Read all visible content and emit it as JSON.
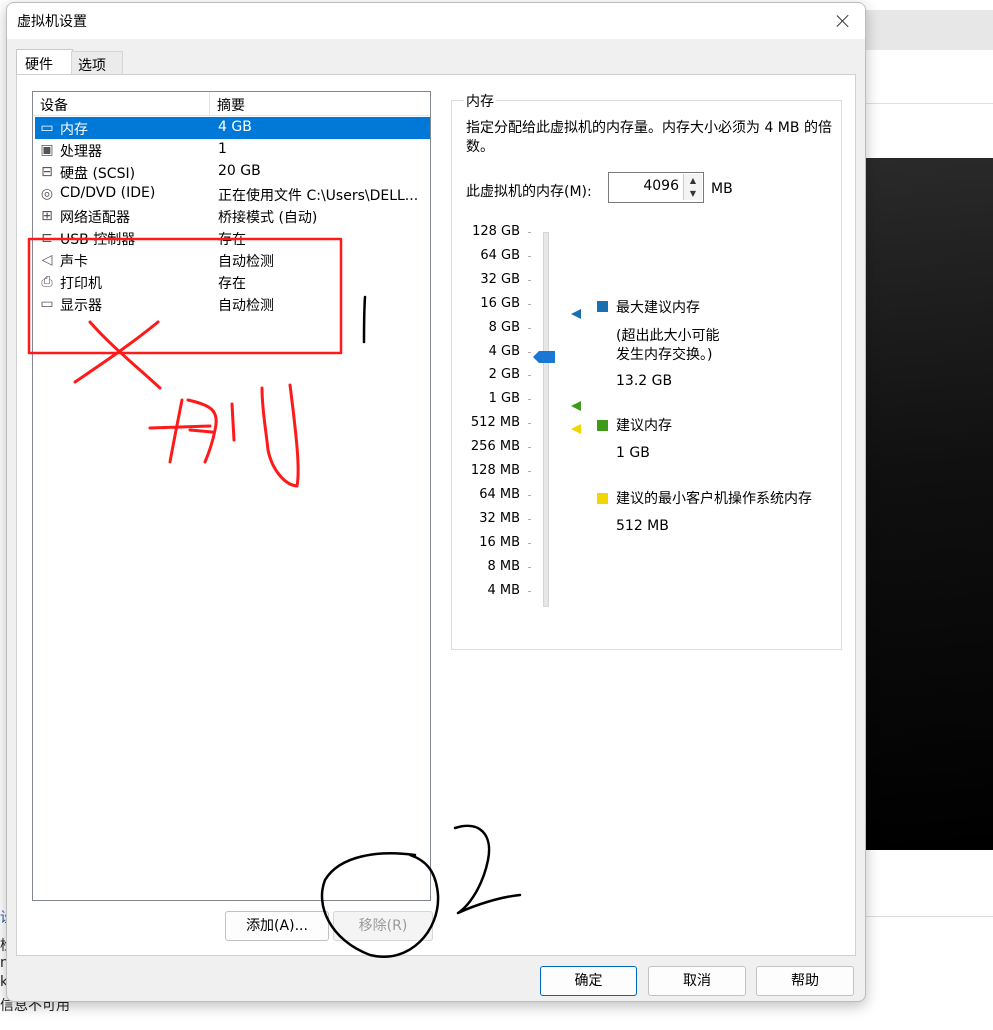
{
  "background": {
    "fragment_lines": [
      "设",
      "检",
      "n",
      "k",
      "信息不可用"
    ]
  },
  "dialog": {
    "title": "虚拟机设置",
    "tabs": [
      {
        "label": "硬件",
        "selected": true
      },
      {
        "label": "选项",
        "selected": false
      }
    ],
    "device_list": {
      "columns": [
        "设备",
        "摘要"
      ],
      "rows": [
        {
          "icon": "memory-icon",
          "name": "内存",
          "summary": "4 GB",
          "selected": true
        },
        {
          "icon": "processor-icon",
          "name": "处理器",
          "summary": "1",
          "selected": false
        },
        {
          "icon": "hard-disk-icon",
          "name": "硬盘 (SCSI)",
          "summary": "20 GB",
          "selected": false
        },
        {
          "icon": "cd-dvd-icon",
          "name": "CD/DVD (IDE)",
          "summary": "正在使用文件 C:\\Users\\DELL...",
          "selected": false
        },
        {
          "icon": "network-adapter-icon",
          "name": "网络适配器",
          "summary": "桥接模式 (自动)",
          "selected": false
        },
        {
          "icon": "usb-controller-icon",
          "name": "USB 控制器",
          "summary": "存在",
          "selected": false
        },
        {
          "icon": "sound-card-icon",
          "name": "声卡",
          "summary": "自动检测",
          "selected": false
        },
        {
          "icon": "printer-icon",
          "name": "打印机",
          "summary": "存在",
          "selected": false
        },
        {
          "icon": "display-icon",
          "name": "显示器",
          "summary": "自动检测",
          "selected": false
        }
      ]
    },
    "add_button": "添加(A)...",
    "remove_button": "移除(R)",
    "ok_button": "确定",
    "cancel_button": "取消",
    "help_button": "帮助"
  },
  "memory": {
    "group_label": "内存",
    "description": "指定分配给此虚拟机的内存量。内存大小必须为 4 MB 的倍数。",
    "input_label": "此虚拟机的内存(M):",
    "input_value": "4096",
    "unit": "MB",
    "scale": [
      "128 GB",
      "64 GB",
      "32 GB",
      "16 GB",
      "8 GB",
      "4 GB",
      "2 GB",
      "1 GB",
      "512 MB",
      "256 MB",
      "128 MB",
      "64 MB",
      "32 MB",
      "16 MB",
      "8 MB",
      "4 MB"
    ],
    "current": "4 GB",
    "legend": {
      "max": {
        "label": "最大建议内存",
        "note_line1": "(超出此大小可能",
        "note_line2": "发生内存交换。)",
        "value": "13.2 GB",
        "color": "#1a6fb0"
      },
      "recommended": {
        "label": "建议内存",
        "value": "1 GB",
        "color": "#3d9a1a"
      },
      "min_guest": {
        "label": "建议的最小客户机操作系统内存",
        "value": "512 MB",
        "color": "#f2d600"
      }
    }
  },
  "annotations": {
    "red_mark_text": "删",
    "black_mark_text": "2",
    "red_color": "#ff1a1a",
    "black_color": "#000000"
  }
}
